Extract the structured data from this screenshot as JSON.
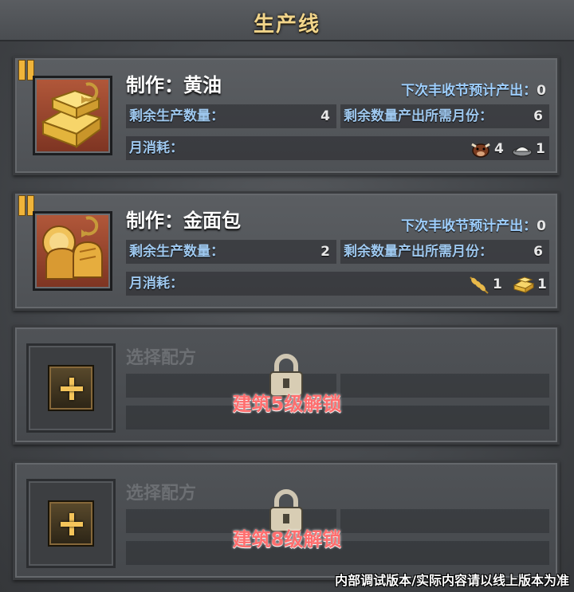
{
  "title": "生产线",
  "forecast_label": "下次丰收节预计产出：",
  "remaining_label": "剩余生产数量：",
  "months_label": "剩余数量产出所需月份：",
  "consumption_label": "月消耗：",
  "recipes": [
    {
      "name": "制作：黄油",
      "icon": "butter-icon",
      "forecast": "0",
      "remaining": "4",
      "months": "6",
      "consumption": [
        {
          "icon": "cow-icon",
          "qty": "4"
        },
        {
          "icon": "salt-icon",
          "qty": "1"
        }
      ]
    },
    {
      "name": "制作：金面包",
      "icon": "golden-bread-icon",
      "forecast": "0",
      "remaining": "2",
      "months": "6",
      "consumption": [
        {
          "icon": "wheat-icon",
          "qty": "1"
        },
        {
          "icon": "butter-icon",
          "qty": "1"
        }
      ]
    }
  ],
  "locked_slots": [
    {
      "label": "选择配方",
      "unlock": "建筑5级解锁"
    },
    {
      "label": "选择配方",
      "unlock": "建筑8级解锁"
    }
  ],
  "footer_note": "内部调试版本/实际内容请以线上版本为准",
  "colors": {
    "title": "#f2d58a",
    "label_blue": "#9fc9f0",
    "pause": "#f0b43a",
    "unlock_red": "#ff6e6e"
  }
}
